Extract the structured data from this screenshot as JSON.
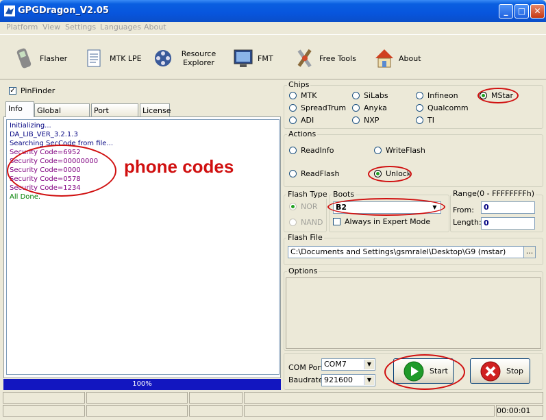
{
  "window": {
    "title": "GPGDragon_V2.05"
  },
  "menu": [
    "Platform",
    "View",
    "Settings",
    "Languages",
    "About"
  ],
  "toolbar": [
    {
      "label": "Flasher",
      "icon": "phone-icon"
    },
    {
      "label": "MTK LPE",
      "icon": "document-icon"
    },
    {
      "label": "Resource Explorer",
      "icon": "film-reel-icon"
    },
    {
      "label": "FMT",
      "icon": "monitor-icon"
    },
    {
      "label": "Free Tools",
      "icon": "tools-icon"
    },
    {
      "label": "About",
      "icon": "house-icon"
    }
  ],
  "pinfinder": {
    "label": "PinFinder",
    "checked": true
  },
  "tabs": [
    "Info",
    "Global Settings",
    "Port Monitor",
    "License"
  ],
  "log": [
    {
      "text": "Initializing...",
      "color": "#000080"
    },
    {
      "text": "DA_LIB_VER_3.2.1.3",
      "color": "#000080"
    },
    {
      "text": "Searching SecCode from file...",
      "color": "#000080"
    },
    {
      "text": "Security Code=6952",
      "color": "#800080"
    },
    {
      "text": "Security Code=00000000",
      "color": "#800080"
    },
    {
      "text": "Security Code=0000",
      "color": "#800080"
    },
    {
      "text": "Security Code=0578",
      "color": "#800080"
    },
    {
      "text": "Security Code=1234",
      "color": "#800080"
    },
    {
      "text": "All Done.",
      "color": "#008000"
    }
  ],
  "annotation": "phone codes",
  "progress": {
    "label": "100%",
    "value": 1.0
  },
  "chips": {
    "title": "Chips",
    "items": [
      "MTK",
      "SiLabs",
      "Infineon",
      "MStar",
      "SpreadTrum",
      "Anyka",
      "Qualcomm",
      "ADI",
      "NXP",
      "TI"
    ],
    "selected": "MStar"
  },
  "actions": {
    "title": "Actions",
    "items": [
      "ReadInfo",
      "WriteFlash",
      "ReadFlash",
      "Unlock"
    ],
    "selected": "Unlock"
  },
  "flash_type": {
    "title": "Flash Type",
    "items": [
      "NOR",
      "NAND"
    ],
    "selected": "NOR"
  },
  "boots": {
    "title": "Boots",
    "value": "B2",
    "expert_label": "Always in Expert Mode"
  },
  "range": {
    "title": "Range(0 - FFFFFFFFh)",
    "from_label": "From:",
    "from_value": "0",
    "length_label": "Length:",
    "length_value": "0"
  },
  "flash_file": {
    "title": "Flash File",
    "path": "C:\\Documents and Settings\\gsmralel\\Desktop\\G9 (mstar)",
    "browse": "..."
  },
  "options": {
    "title": "Options"
  },
  "com_port": {
    "label": "COM Port",
    "value": "COM7"
  },
  "baudrate": {
    "label": "Baudrate",
    "value": "921600"
  },
  "start": {
    "label": "Start"
  },
  "stop": {
    "label": "Stop"
  },
  "status": {
    "time": "00:00:01"
  },
  "colors": {
    "titlebar": "#0855dd",
    "progress": "#1216c0",
    "highlight": "#d01010"
  }
}
